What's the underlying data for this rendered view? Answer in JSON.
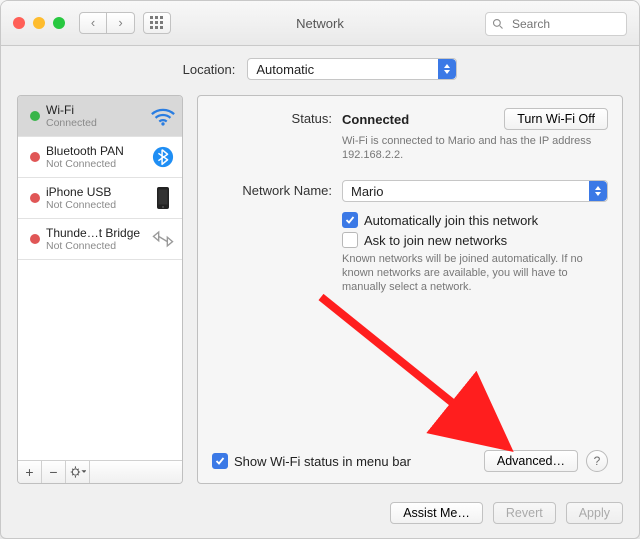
{
  "window": {
    "title": "Network"
  },
  "toolbar": {
    "search_placeholder": "Search"
  },
  "location": {
    "label": "Location:",
    "value": "Automatic"
  },
  "sidebar": {
    "services": [
      {
        "name": "Wi-Fi",
        "sub": "Connected",
        "status": "green",
        "icon": "wifi",
        "selected": true
      },
      {
        "name": "Bluetooth PAN",
        "sub": "Not Connected",
        "status": "red",
        "icon": "bluetooth",
        "selected": false
      },
      {
        "name": "iPhone USB",
        "sub": "Not Connected",
        "status": "red",
        "icon": "iphone",
        "selected": false
      },
      {
        "name": "Thunde…t Bridge",
        "sub": "Not Connected",
        "status": "red",
        "icon": "thunderbolt",
        "selected": false
      }
    ]
  },
  "main": {
    "status_label": "Status:",
    "status_value": "Connected",
    "wifi_toggle": "Turn Wi-Fi Off",
    "status_desc": "Wi-Fi is connected to Mario and has the IP address 192.168.2.2.",
    "network_name_label": "Network Name:",
    "network_name_value": "Mario",
    "auto_join": {
      "label": "Automatically join this network",
      "checked": true
    },
    "ask_join": {
      "label": "Ask to join new networks",
      "checked": false
    },
    "ask_join_desc": "Known networks will be joined automatically. If no known networks are available, you will have to manually select a network.",
    "menubar_checkbox": {
      "label": "Show Wi-Fi status in menu bar",
      "checked": true
    },
    "advanced": "Advanced…",
    "help": "?"
  },
  "footer": {
    "assist": "Assist Me…",
    "revert": "Revert",
    "apply": "Apply"
  }
}
